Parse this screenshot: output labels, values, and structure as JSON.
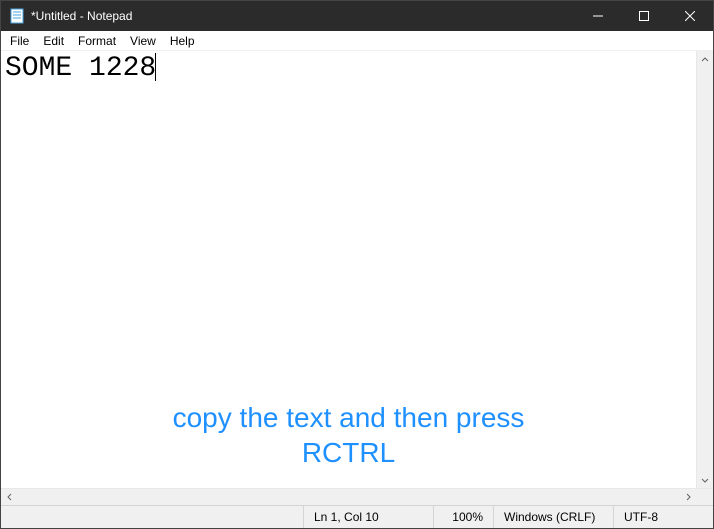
{
  "window": {
    "title": "*Untitled - Notepad"
  },
  "menu": {
    "file": "File",
    "edit": "Edit",
    "format": "Format",
    "view": "View",
    "help": "Help"
  },
  "editor": {
    "content": "SOME 1228"
  },
  "overlay": {
    "line1": "copy the text and then press",
    "line2": "RCTRL"
  },
  "status": {
    "position": "Ln 1, Col 10",
    "zoom": "100%",
    "line_ending": "Windows (CRLF)",
    "encoding": "UTF-8"
  }
}
